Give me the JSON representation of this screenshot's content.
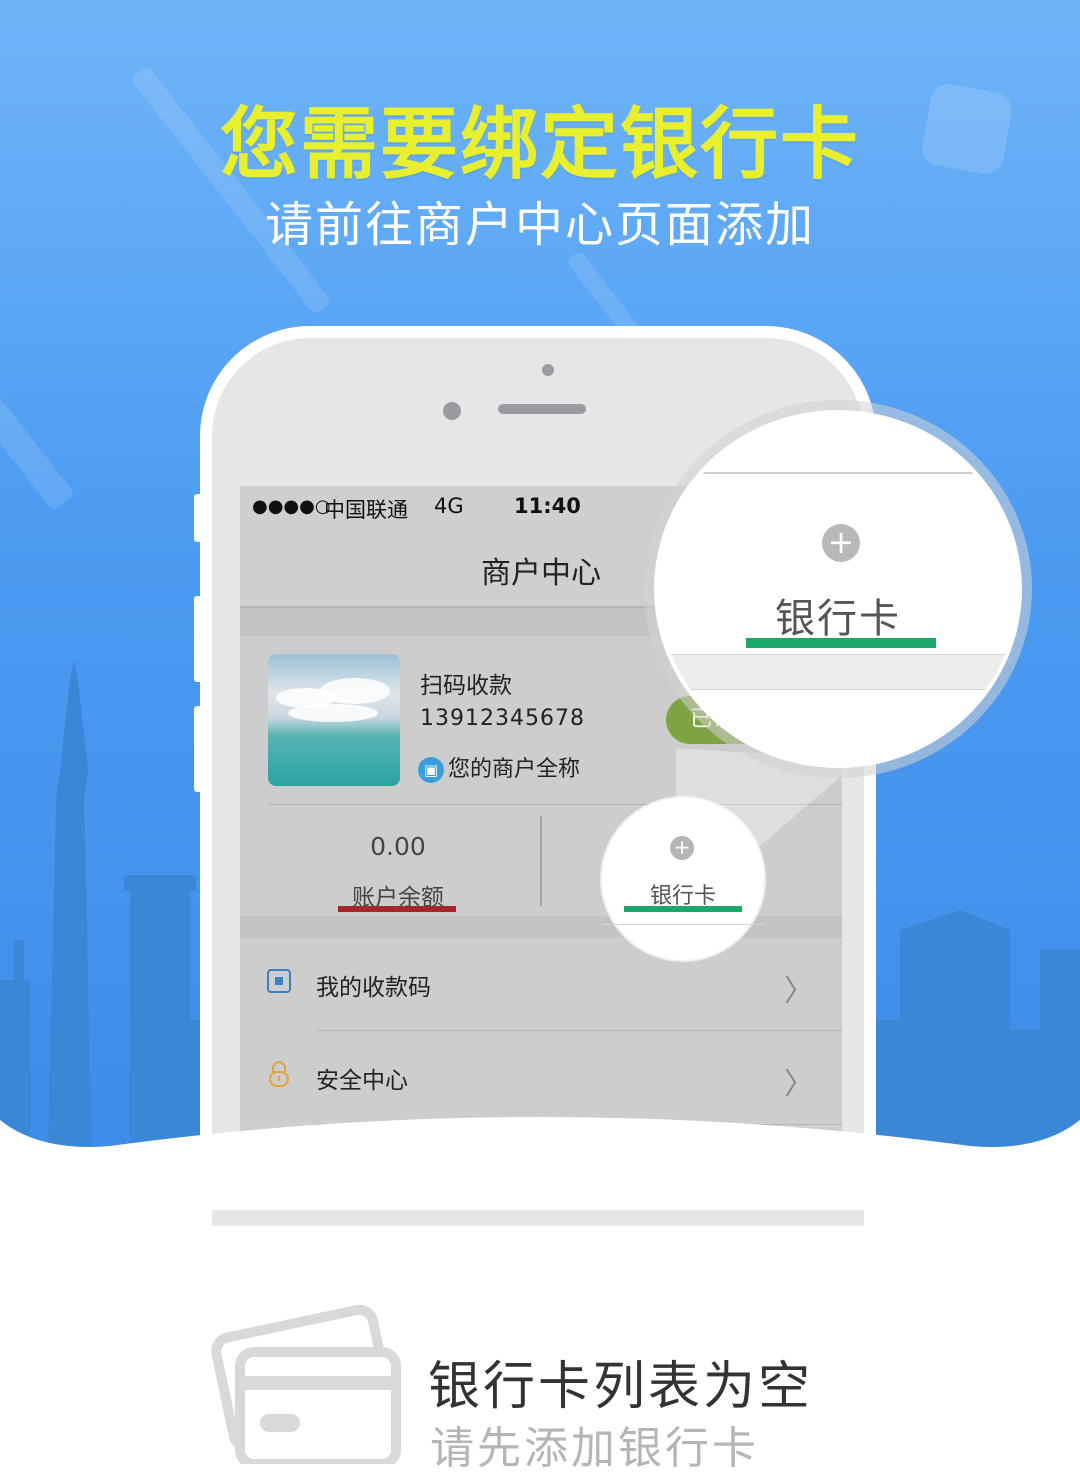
{
  "hero": {
    "title": "您需要绑定银行卡",
    "subtitle": "请前往商户中心页面添加"
  },
  "status_bar": {
    "signal": "●●●●○",
    "carrier": "中国联通",
    "network": "4G",
    "time": "11:40"
  },
  "nav": {
    "title": "商户中心"
  },
  "merchant": {
    "name": "扫码收款",
    "phone": "13912345678",
    "full_name": "您的商户全称",
    "verified_label": "已认"
  },
  "account": {
    "balance_value": "0.00",
    "balance_label": "账户余额",
    "bank_card_label": "银行卡"
  },
  "menu": [
    {
      "label": "我的收款码",
      "icon": "qr-code-icon"
    },
    {
      "label": "安全中心",
      "icon": "lock-icon"
    }
  ],
  "magnifier": {
    "label": "银行卡",
    "icon": "plus-circle-icon"
  },
  "empty_state": {
    "title": "银行卡列表为空",
    "subtitle": "请先添加银行卡",
    "icon": "bank-cards-icon"
  },
  "colors": {
    "hero_blue": "#4d9cf2",
    "title_yellow": "#e8ef2e",
    "highlight_green": "#1aa86b",
    "highlight_red": "#a8262b"
  }
}
